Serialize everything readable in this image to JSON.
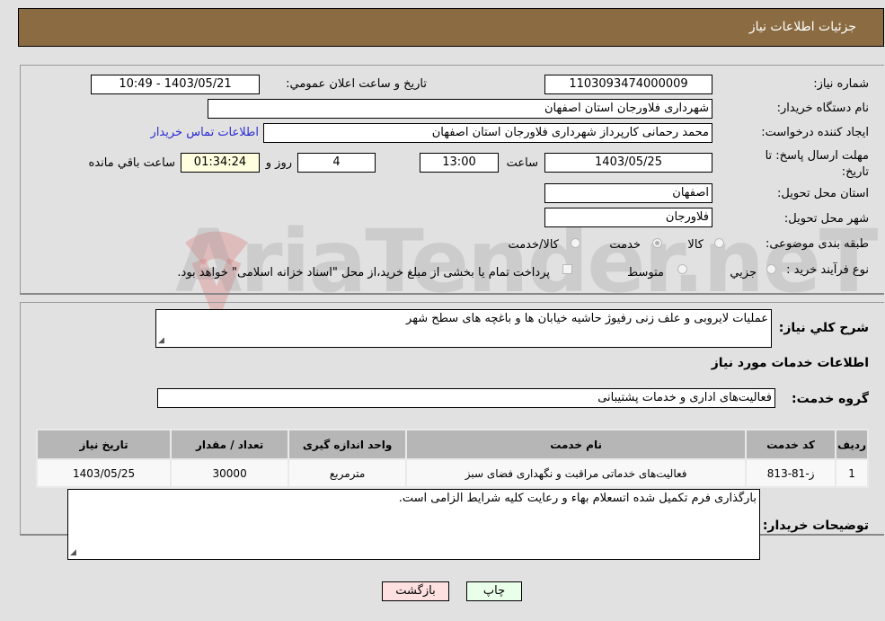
{
  "header": {
    "title": "جزئیات اطلاعات نیاز"
  },
  "form": {
    "need_number_label": "شماره نیاز:",
    "need_number": "1103093474000009",
    "announce_label": "تاریخ و ساعت اعلان عمومي:",
    "announce_value": "1403/05/21 - 10:49",
    "buyer_org_label": "نام دستگاه خریدار:",
    "buyer_org": "شهرداری فلاورجان استان اصفهان",
    "creator_label": "ایجاد کننده درخواست:",
    "creator": "محمد رحمانی کارپرداز شهرداری فلاورجان استان اصفهان",
    "contact_link": "اطلاعات تماس خریدار",
    "deadline_label": "مهلت ارسال پاسخ: تا تاریخ:",
    "deadline_date": "1403/05/25",
    "time_label": "ساعت",
    "deadline_time": "13:00",
    "days": "4",
    "days_label": "روز و",
    "remaining": "01:34:24",
    "remaining_label": "ساعت باقي مانده",
    "province_label": "استان محل تحویل:",
    "province": "اصفهان",
    "city_label": "شهر محل تحویل:",
    "city": "فلاورجان",
    "category_label": "طبقه بندی موضوعی:",
    "category_options": [
      {
        "label": "کالا",
        "checked": false
      },
      {
        "label": "خدمت",
        "checked": true
      },
      {
        "label": "کالا/خدمت",
        "checked": false
      }
    ],
    "purchase_type_label": "نوع فرآیند خرید :",
    "purchase_options": [
      {
        "label": "جزیي",
        "checked": false
      },
      {
        "label": "متوسط",
        "checked": false
      }
    ],
    "treasury_note": "پرداخت تمام یا بخشی از مبلغ خرید،از محل \"اسناد خزانه اسلامی\" خواهد بود."
  },
  "details": {
    "description_label": "شرح کلي نیاز:",
    "description": "عملیات لایروبی و علف زنی رفیوژ حاشیه خیابان ها و باغچه های سطح شهر",
    "services_heading": "اطلاعات خدمات مورد نیاز",
    "service_group_label": "گروه خدمت:",
    "service_group": "فعالیت‌های اداری و خدمات پشتیبانی",
    "table": {
      "columns": [
        "ردیف",
        "کد خدمت",
        "نام خدمت",
        "واحد اندازه گیری",
        "تعداد / مقدار",
        "تاریخ نیاز"
      ],
      "rows": [
        [
          "1",
          "ز-81-813",
          "فعالیت‌های خدماتی مراقبت و نگهداری فضای سبز",
          "مترمربع",
          "30000",
          "1403/05/25"
        ]
      ]
    },
    "buyer_notes_label": "توضیحات خریدار:",
    "buyer_notes": "بارگذاری فرم تکمیل شده اتسعلام بهاء و رعایت کلیه شرایط الزامی است."
  },
  "buttons": {
    "print": "چاپ",
    "back": "بازگشت"
  },
  "colors": {
    "header": "#8b6c42",
    "print_bg": "#eaffea",
    "back_bg": "#ffe0e0",
    "link": "#2a2ad6"
  },
  "watermark": "AriaTender.neT"
}
